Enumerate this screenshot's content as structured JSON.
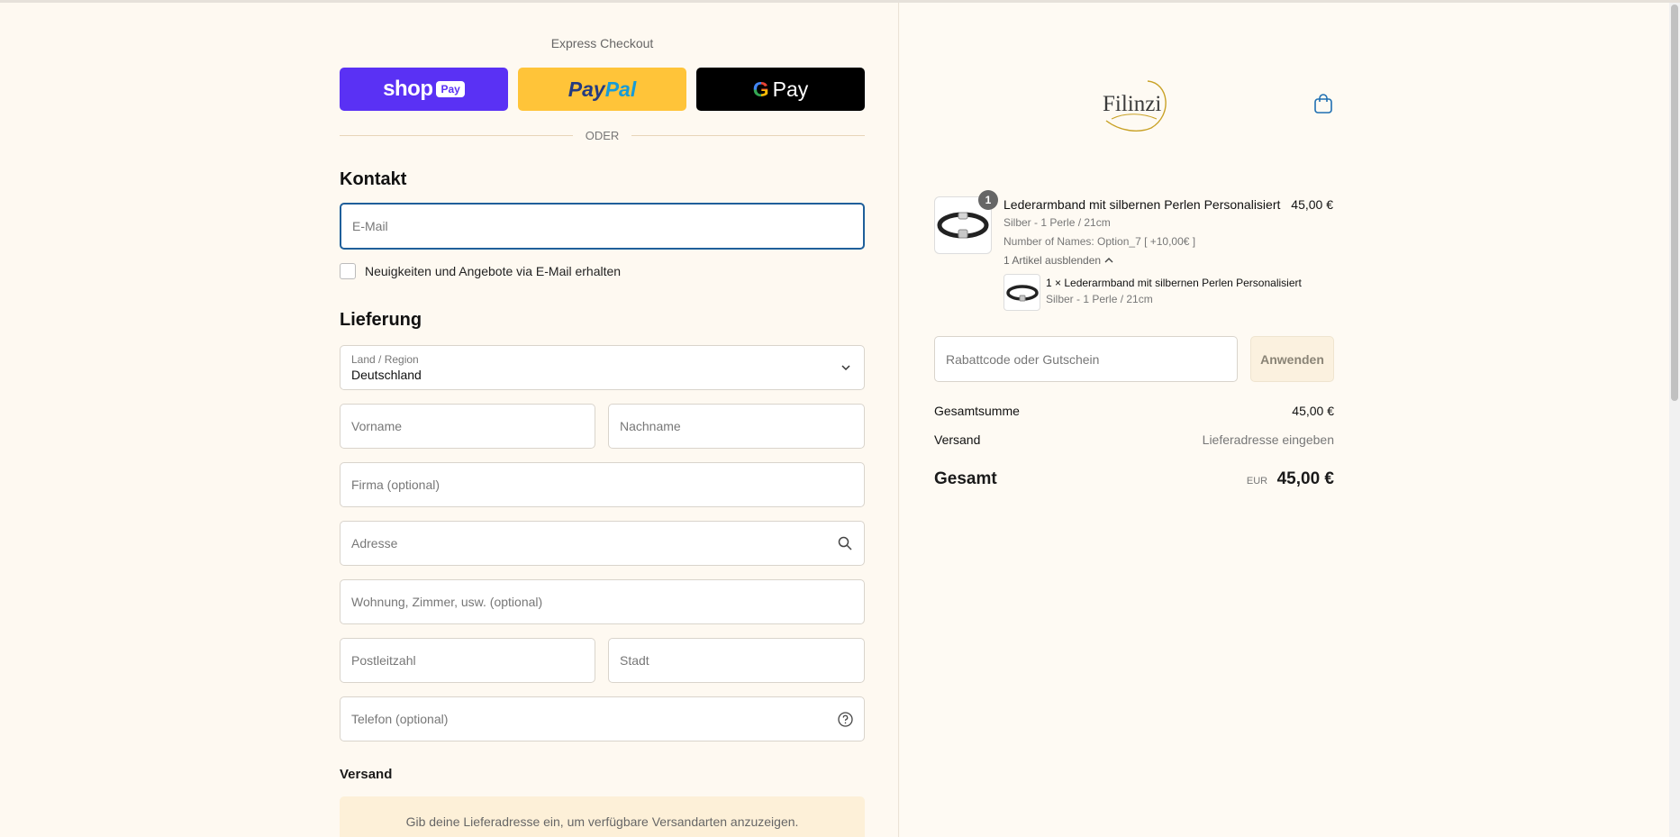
{
  "express": {
    "title": "Express Checkout",
    "shop_word": "shop",
    "shop_pill": "Pay",
    "paypal_a": "Pay",
    "paypal_b": "Pal",
    "gpay_g": "G",
    "gpay_word": "Pay",
    "divider": "ODER"
  },
  "contact": {
    "title": "Kontakt",
    "email_placeholder": "E-Mail",
    "newsletter_label": "Neuigkeiten und Angebote via E-Mail erhalten"
  },
  "delivery": {
    "title": "Lieferung",
    "country_label": "Land / Region",
    "country_value": "Deutschland",
    "first_name": "Vorname",
    "last_name": "Nachname",
    "company": "Firma (optional)",
    "address": "Adresse",
    "apartment": "Wohnung, Zimmer, usw. (optional)",
    "postal": "Postleitzahl",
    "city": "Stadt",
    "phone": "Telefon (optional)"
  },
  "shipping": {
    "title": "Versand",
    "note": "Gib deine Lieferadresse ein, um verfügbare Versandarten anzuzeigen."
  },
  "brand": {
    "name": "Filinzi",
    "accent": "#c9a227"
  },
  "cart": {
    "qty": "1",
    "product_name": "Lederarmband mit silbernen Perlen Personalisiert",
    "price": "45,00 €",
    "variant": "Silber - 1 Perle / 21cm",
    "option": "Number of Names: Option_7 [ +10,00€ ]",
    "hide_link": "1 Artikel ausblenden",
    "sub_item": "1 × Lederarmband mit silbernen Perlen Personalisiert",
    "sub_variant": "Silber - 1 Perle / 21cm"
  },
  "discount": {
    "placeholder": "Rabattcode oder Gutschein",
    "apply": "Anwenden"
  },
  "summary": {
    "subtotal_label": "Gesamtsumme",
    "subtotal_value": "45,00 €",
    "shipping_label": "Versand",
    "shipping_value": "Lieferadresse eingeben",
    "total_label": "Gesamt",
    "currency": "EUR",
    "total_value": "45,00 €"
  }
}
